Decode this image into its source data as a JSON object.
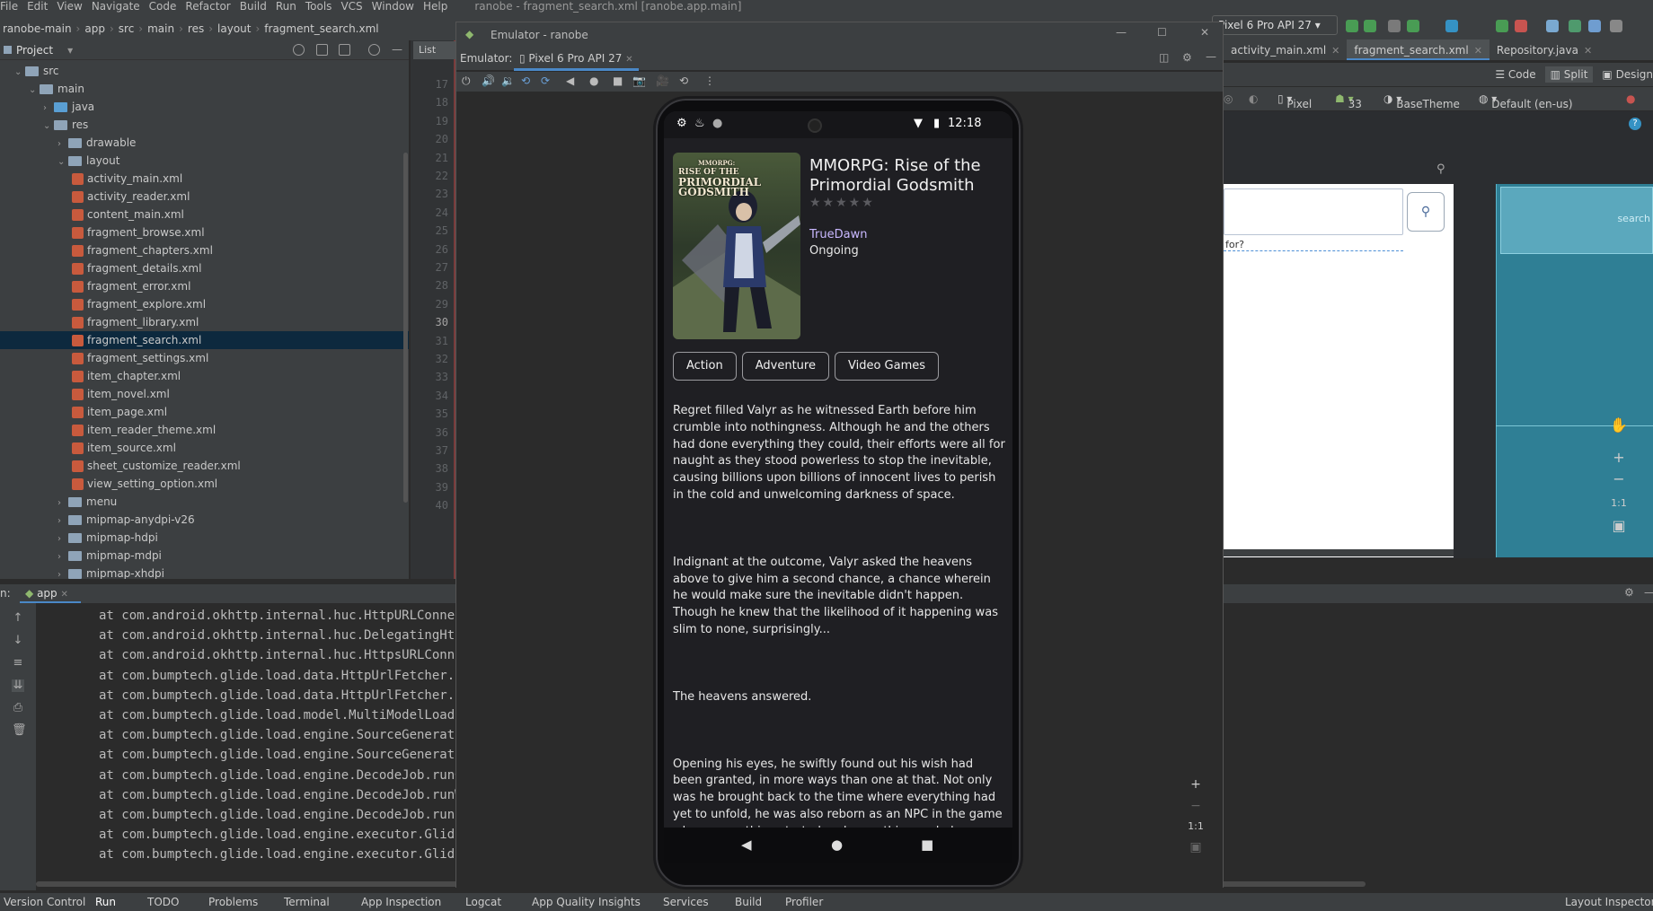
{
  "menu": [
    "File",
    "Edit",
    "View",
    "Navigate",
    "Code",
    "Refactor",
    "Build",
    "Run",
    "Tools",
    "VCS",
    "Window",
    "Help"
  ],
  "window_title": "ranobe - fragment_search.xml [ranobe.app.main]",
  "breadcrumb": [
    "ranobe-main",
    "app",
    "src",
    "main",
    "res",
    "layout",
    "fragment_search.xml"
  ],
  "device_selector": "Pixel 6 Pro API 27",
  "project_panel": {
    "title": "Project",
    "tree": [
      {
        "label": "src",
        "depth": 1,
        "type": "folder",
        "open": true
      },
      {
        "label": "main",
        "depth": 2,
        "type": "folder",
        "open": true
      },
      {
        "label": "java",
        "depth": 3,
        "type": "folder-blue",
        "open": false
      },
      {
        "label": "res",
        "depth": 3,
        "type": "folder",
        "open": true
      },
      {
        "label": "drawable",
        "depth": 4,
        "type": "folder",
        "open": false
      },
      {
        "label": "layout",
        "depth": 4,
        "type": "folder",
        "open": true
      },
      {
        "label": "activity_main.xml",
        "depth": 5,
        "type": "xml"
      },
      {
        "label": "activity_reader.xml",
        "depth": 5,
        "type": "xml"
      },
      {
        "label": "content_main.xml",
        "depth": 5,
        "type": "xml"
      },
      {
        "label": "fragment_browse.xml",
        "depth": 5,
        "type": "xml"
      },
      {
        "label": "fragment_chapters.xml",
        "depth": 5,
        "type": "xml"
      },
      {
        "label": "fragment_details.xml",
        "depth": 5,
        "type": "xml"
      },
      {
        "label": "fragment_error.xml",
        "depth": 5,
        "type": "xml"
      },
      {
        "label": "fragment_explore.xml",
        "depth": 5,
        "type": "xml"
      },
      {
        "label": "fragment_library.xml",
        "depth": 5,
        "type": "xml"
      },
      {
        "label": "fragment_search.xml",
        "depth": 5,
        "type": "xml",
        "selected": true
      },
      {
        "label": "fragment_settings.xml",
        "depth": 5,
        "type": "xml"
      },
      {
        "label": "item_chapter.xml",
        "depth": 5,
        "type": "xml"
      },
      {
        "label": "item_novel.xml",
        "depth": 5,
        "type": "xml"
      },
      {
        "label": "item_page.xml",
        "depth": 5,
        "type": "xml"
      },
      {
        "label": "item_reader_theme.xml",
        "depth": 5,
        "type": "xml"
      },
      {
        "label": "item_source.xml",
        "depth": 5,
        "type": "xml"
      },
      {
        "label": "sheet_customize_reader.xml",
        "depth": 5,
        "type": "xml"
      },
      {
        "label": "view_setting_option.xml",
        "depth": 5,
        "type": "xml"
      },
      {
        "label": "menu",
        "depth": 4,
        "type": "folder",
        "open": false
      },
      {
        "label": "mipmap-anydpi-v26",
        "depth": 4,
        "type": "folder",
        "open": false
      },
      {
        "label": "mipmap-hdpi",
        "depth": 4,
        "type": "folder",
        "open": false
      },
      {
        "label": "mipmap-mdpi",
        "depth": 4,
        "type": "folder",
        "open": false
      },
      {
        "label": "mipmap-xhdpi",
        "depth": 4,
        "type": "folder",
        "open": false
      }
    ]
  },
  "gutter_lines": [
    "17",
    "18",
    "19",
    "20",
    "21",
    "22",
    "23",
    "24",
    "25",
    "26",
    "27",
    "28",
    "29",
    "30",
    "31",
    "32",
    "33",
    "34",
    "35",
    "36",
    "37",
    "38",
    "39",
    "40"
  ],
  "editor_tab_partial": "List",
  "editor_tabs": [
    {
      "label": "activity_main.xml",
      "active": false
    },
    {
      "label": "fragment_search.xml",
      "active": true
    },
    {
      "label": "Repository.java",
      "active": false
    }
  ],
  "view_modes": [
    "Code",
    "Split",
    "Design"
  ],
  "design_toolbar": {
    "device": "Pixel",
    "api": "33",
    "theme": "BaseTheme",
    "locale": "Default (en-us)"
  },
  "preview": {
    "hint_text": "for?",
    "search_hint": "search"
  },
  "zoom": {
    "one_to_one": "1:1"
  },
  "run_panel": {
    "tab": "app",
    "lines": [
      "at com.android.okhttp.internal.huc.HttpURLConnectionImpl",
      "at com.android.okhttp.internal.huc.DelegatingHttpsURLConnection",
      "at com.android.okhttp.internal.huc.HttpsURLConnectionImpl",
      "at com.bumptech.glide.load.data.HttpUrlFetcher.loadData",
      "at com.bumptech.glide.load.data.HttpUrlFetcher.loadData",
      "at com.bumptech.glide.load.model.MultiModelLoader$",
      "at com.bumptech.glide.load.engine.SourceGenerator.",
      "at com.bumptech.glide.load.engine.SourceGenerator.",
      "at com.bumptech.glide.load.engine.DecodeJob.runGenerators",
      "at com.bumptech.glide.load.engine.DecodeJob.runWrapped",
      "at com.bumptech.glide.load.engine.DecodeJob.run(DecodeJob",
      "at com.bumptech.glide.load.engine.executor.GlideExecutor",
      "at com.bumptech.glide.load.engine.executor.GlideExecutor"
    ]
  },
  "statusbar": [
    "Version Control",
    "Run",
    "TODO",
    "Problems",
    "Terminal",
    "App Inspection",
    "Logcat",
    "App Quality Insights",
    "Services",
    "Build",
    "Profiler",
    "Layout Inspector"
  ],
  "emulator": {
    "title": "Emulator - ranobe",
    "label": "Emulator:",
    "device_tab": "Pixel 6 Pro API 27"
  },
  "phone": {
    "time": "12:18",
    "novel": {
      "title": "MMORPG: Rise of the Primordial Godsmith",
      "author": "TrueDawn",
      "status": "Ongoing",
      "rating": 0,
      "genres": [
        "Action",
        "Adventure",
        "Video Games"
      ],
      "cover_text": [
        "MMORPG:",
        "RISE OF THE",
        "PRIMORDIAL",
        "GODSMITH"
      ],
      "description": [
        "Regret filled Valyr as he witnessed Earth before him crumble into nothingness. Although he and the others had done everything they could, their efforts were all for naught as they stood powerless to stop the inevitable, causing billions upon billions of innocent lives to perish in the cold and unwelcoming darkness of space.",
        "Indignant at the outcome, Valyr asked the heavens above to give him a second chance, a chance wherein he would make sure the inevitable didn't happen. Though he knew that the likelihood of it happening was slim to none, surprisingly...",
        "The heavens answered.",
        "Opening his eyes, he swiftly found out his wish had been granted, in more ways than one at that. Not only was he brought back to the time where everything had yet to unfold, he was also reborn as an NPC in the game where everything started and everything ended."
      ]
    }
  },
  "colors": {
    "accent": "#4a88c7",
    "author": "#c9b8ff",
    "xml_icon": "#c85a3d"
  }
}
